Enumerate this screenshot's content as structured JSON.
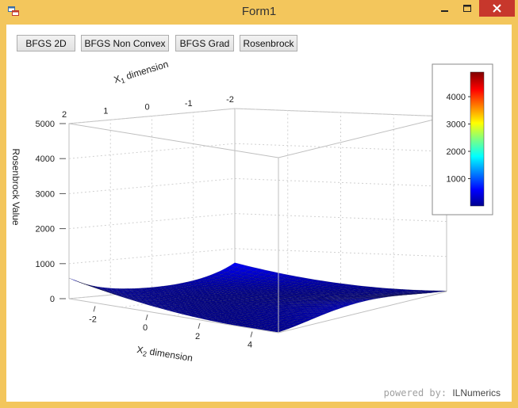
{
  "window": {
    "title": "Form1",
    "controls": {
      "minimize": "minimize-icon",
      "maximize": "maximize-icon",
      "close": "close-icon"
    }
  },
  "toolbar": {
    "buttons": [
      "BFGS 2D",
      "BFGS Non Convex",
      "BFGS Grad",
      "Rosenbrock"
    ]
  },
  "plot": {
    "z_axis_label": "Rosenbrock Value",
    "x1_axis": {
      "label_prefix": "X",
      "label_sub": "1",
      "label_suffix": " dimension",
      "ticks": [
        "2",
        "1",
        "0",
        "-1",
        "-2"
      ]
    },
    "x2_axis": {
      "label_prefix": "X",
      "label_sub": "2",
      "label_suffix": " dimension",
      "ticks": [
        "-2",
        "0",
        "2",
        "4"
      ]
    },
    "z_ticks": [
      "5000",
      "4000",
      "3000",
      "2000",
      "1000",
      "0"
    ],
    "colorbar_ticks": [
      "4000",
      "3000",
      "2000",
      "1000"
    ],
    "colormap": [
      "#00008f",
      "#0000ff",
      "#0080ff",
      "#00ffff",
      "#80ff80",
      "#ffff00",
      "#ff8000",
      "#ff0000",
      "#800000"
    ],
    "surface_function": "Rosenbrock"
  },
  "footer": {
    "powered_by": "powered by:",
    "brand": "ILNumerics"
  }
}
